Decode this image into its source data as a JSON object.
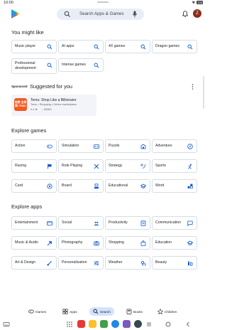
{
  "status_bar": {
    "time": "10:00",
    "battery": "100"
  },
  "search": {
    "label": "Search Apps & Games"
  },
  "profile": {
    "initial": "Z"
  },
  "suggestions": {
    "title": "You might like",
    "chips": [
      "Music player",
      "AI apps",
      "4X games",
      "Dragon games",
      "Professional development",
      "Intense games"
    ]
  },
  "sponsored": {
    "tag": "Sponsored",
    "title": "Suggested for you",
    "ad": {
      "logo_text": "免费 全球购 TEMU",
      "name": "Temu: Shop Like a Billionaire",
      "subtitle": "Temu • Shopping • Online marketplace",
      "rating": "4.4 ★",
      "downloads": "↓ 500M+"
    }
  },
  "explore_games": {
    "title": "Explore games",
    "items": [
      {
        "label": "Action",
        "icon": "controller-icon"
      },
      {
        "label": "Simulation",
        "icon": "simulation-icon"
      },
      {
        "label": "Puzzle",
        "icon": "puzzle-icon"
      },
      {
        "label": "Adventure",
        "icon": "compass-icon"
      },
      {
        "label": "Racing",
        "icon": "flag-icon"
      },
      {
        "label": "Role Playing",
        "icon": "sword-icon"
      },
      {
        "label": "Strategy",
        "icon": "strategy-icon"
      },
      {
        "label": "Sports",
        "icon": "sports-icon"
      },
      {
        "label": "Card",
        "icon": "card-icon"
      },
      {
        "label": "Board",
        "icon": "board-icon"
      },
      {
        "label": "Educational",
        "icon": "school-icon"
      },
      {
        "label": "Word",
        "icon": "word-icon"
      }
    ]
  },
  "explore_apps": {
    "title": "Explore apps",
    "items": [
      {
        "label": "Entertainment",
        "icon": "entertainment-icon"
      },
      {
        "label": "Social",
        "icon": "people-icon"
      },
      {
        "label": "Productivity",
        "icon": "productivity-icon"
      },
      {
        "label": "Communication",
        "icon": "chat-icon"
      },
      {
        "label": "Music & Audio",
        "icon": "music-icon"
      },
      {
        "label": "Photography",
        "icon": "camera-icon"
      },
      {
        "label": "Shopping",
        "icon": "shopping-bag-icon"
      },
      {
        "label": "Education",
        "icon": "school-icon"
      },
      {
        "label": "Art & Design",
        "icon": "brush-icon"
      },
      {
        "label": "Personalisation",
        "icon": "sliders-icon"
      },
      {
        "label": "Weather",
        "icon": "weather-icon"
      },
      {
        "label": "Beauty",
        "icon": "beauty-icon"
      }
    ]
  },
  "bottom_nav": {
    "items": [
      {
        "label": "Games",
        "icon": "games-icon",
        "active": false
      },
      {
        "label": "Apps",
        "icon": "apps-icon",
        "active": false
      },
      {
        "label": "Search",
        "icon": "search-icon",
        "active": true
      },
      {
        "label": "Books",
        "icon": "books-icon",
        "active": false
      },
      {
        "label": "Children",
        "icon": "children-icon",
        "active": false
      }
    ]
  },
  "colors": {
    "accent": "#0b57d0",
    "chip_border": "#d6dce6",
    "active_nav": "#d3e3fd",
    "search_bg": "#e8edf7"
  }
}
